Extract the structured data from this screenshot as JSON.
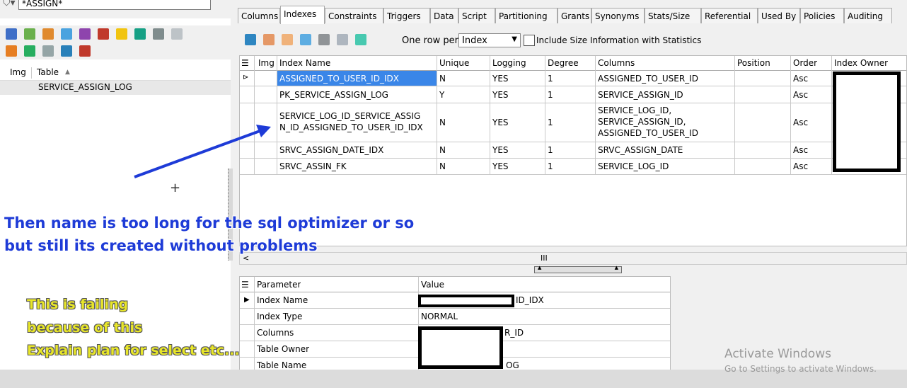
{
  "filter": {
    "value": "*ASSIGN*"
  },
  "object_list": {
    "headers": [
      "Img",
      "Table"
    ],
    "rows": [
      "SERVICE_ASSIGN_LOG"
    ]
  },
  "tabs": [
    "Columns",
    "Indexes",
    "Constraints",
    "Triggers",
    "Data",
    "Script",
    "Partitioning",
    "Grants",
    "Synonyms",
    "Stats/Size",
    "Referential",
    "Used By",
    "Policies",
    "Auditing"
  ],
  "active_tab": "Indexes",
  "toolbar": {
    "one_row_per_label": "One row per:",
    "one_row_per_value": "Index",
    "include_size_label": "Include Size Information with Statistics"
  },
  "grid": {
    "headers": [
      "Img",
      "Index Name",
      "Unique",
      "Logging",
      "Degree",
      "Columns",
      "Position",
      "Order",
      "Index Owner"
    ],
    "rows": [
      {
        "name": [
          "ASSIGNED_TO_USER_ID_IDX"
        ],
        "unique": "N",
        "logging": "YES",
        "degree": "1",
        "columns": [
          "ASSIGNED_TO_USER_ID"
        ],
        "order": "Asc"
      },
      {
        "name": [
          "PK_SERVICE_ASSIGN_LOG"
        ],
        "unique": "Y",
        "logging": "YES",
        "degree": "1",
        "columns": [
          "SERVICE_ASSIGN_ID"
        ],
        "order": "Asc"
      },
      {
        "name": [
          "SERVICE_LOG_ID_SERVICE_ASSIG",
          "N_ID_ASSIGNED_TO_USER_ID_IDX"
        ],
        "unique": "N",
        "logging": "YES",
        "degree": "1",
        "columns": [
          "SERVICE_LOG_ID,",
          "SERVICE_ASSIGN_ID,",
          "ASSIGNED_TO_USER_ID"
        ],
        "order": "Asc"
      },
      {
        "name": [
          "SRVC_ASSIGN_DATE_IDX"
        ],
        "unique": "N",
        "logging": "YES",
        "degree": "1",
        "columns": [
          "SRVC_ASSIGN_DATE"
        ],
        "order": "Asc"
      },
      {
        "name": [
          "SRVC_ASSIN_FK"
        ],
        "unique": "N",
        "logging": "YES",
        "degree": "1",
        "columns": [
          "SERVICE_LOG_ID"
        ],
        "order": "Asc"
      }
    ]
  },
  "props": {
    "headers": [
      "Parameter",
      "Value"
    ],
    "rows": [
      {
        "param": "Index Name",
        "value": "ID_IDX"
      },
      {
        "param": "Index Type",
        "value": "NORMAL"
      },
      {
        "param": "Columns",
        "value": "R_ID"
      },
      {
        "param": "Table Owner",
        "value": ""
      },
      {
        "param": "Table Name",
        "value": "OG"
      }
    ]
  },
  "annotations": {
    "blue": [
      "Then name is too long for the sql optimizer or so",
      "but still its created without problems"
    ],
    "yellow": [
      "This is failing",
      "because of this",
      "Explain plan for select etc..."
    ]
  },
  "watermark": {
    "title": "Activate Windows",
    "subtitle": "Go to Settings to activate Windows."
  },
  "scroll_marker": "III",
  "colors": {
    "selected_row": "#3a86e8",
    "blue_note": "#1e3bd7",
    "yellow_note": "#e8e62a"
  }
}
